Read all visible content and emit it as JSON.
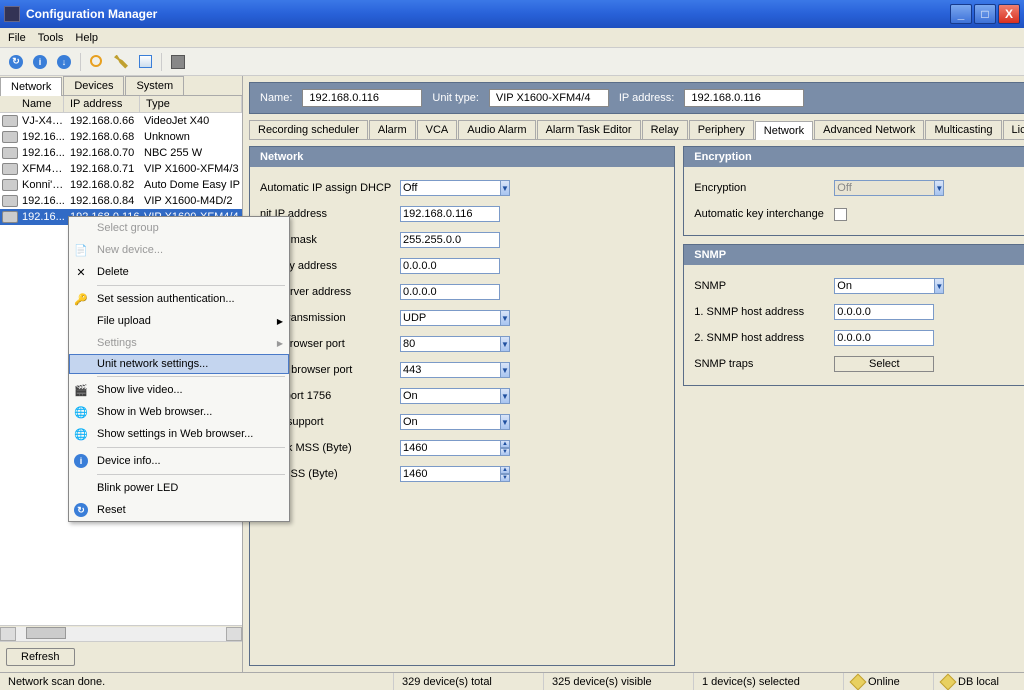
{
  "window": {
    "title": "Configuration Manager"
  },
  "menu": {
    "file": "File",
    "tools": "Tools",
    "help": "Help"
  },
  "left_tabs": {
    "network": "Network",
    "devices": "Devices",
    "system": "System"
  },
  "device_columns": {
    "name": "Name",
    "ip": "IP address",
    "type": "Type"
  },
  "devices": [
    {
      "name": "VJ-X40...",
      "ip": "192.168.0.66",
      "type": "VideoJet X40"
    },
    {
      "name": "192.16...",
      "ip": "192.168.0.68",
      "type": "Unknown"
    },
    {
      "name": "192.16...",
      "ip": "192.168.0.70",
      "type": "NBC 255 W"
    },
    {
      "name": "XFM4A ...",
      "ip": "192.168.0.71",
      "type": "VIP X1600-XFM4/3"
    },
    {
      "name": "Konni's ...",
      "ip": "192.168.0.82",
      "type": "Auto Dome Easy IP"
    },
    {
      "name": "192.16...",
      "ip": "192.168.0.84",
      "type": "VIP X1600-M4D/2"
    },
    {
      "name": "192.16...",
      "ip": "192.168.0.116",
      "type": "VIP X1600-XFM4/4"
    }
  ],
  "context_menu": {
    "select_group": "Select group",
    "new_device": "New device...",
    "delete": "Delete",
    "set_session_auth": "Set session authentication...",
    "file_upload": "File upload",
    "settings": "Settings",
    "unit_network_settings": "Unit network settings...",
    "show_live_video": "Show live video...",
    "show_in_web_browser": "Show in Web browser...",
    "show_settings_web": "Show settings in Web browser...",
    "device_info": "Device info...",
    "blink_power_led": "Blink power LED",
    "reset": "Reset"
  },
  "refresh_btn": "Refresh",
  "info_bar": {
    "name_label": "Name:",
    "name_value": "192.168.0.116",
    "unit_type_label": "Unit type:",
    "unit_type_value": "VIP X1600-XFM4/4",
    "ip_label": "IP address:",
    "ip_value": "192.168.0.116"
  },
  "tabs": {
    "recording": "Recording scheduler",
    "alarm": "Alarm",
    "vca": "VCA",
    "audio_alarm": "Audio Alarm",
    "alarm_task": "Alarm Task Editor",
    "relay": "Relay",
    "periphery": "Periphery",
    "network": "Network",
    "adv_network": "Advanced Network",
    "multicasting": "Multicasting",
    "license": "License"
  },
  "network_panel": {
    "title": "Network",
    "dhcp_label": "Automatic IP assign DHCP",
    "dhcp_value": "Off",
    "unit_ip_label": "nit IP address",
    "unit_ip_value": "192.168.0.116",
    "subnet_label": "ubnet mask",
    "subnet_value": "255.255.0.0",
    "gateway_label": "ateway address",
    "gateway_value": "0.0.0.0",
    "dns_label": "NS server address",
    "dns_value": "0.0.0.0",
    "video_tx_label": "ideo transmission",
    "video_tx_value": "UDP",
    "http_label": "TTP browser port",
    "http_value": "80",
    "https_label": "TTPS browser port",
    "https_value": "443",
    "rcp_label": "CP+ port 1756",
    "rcp_value": "On",
    "telnet_label": "elnet support",
    "telnet_value": "On",
    "mss_label": "etwork MSS (Byte)",
    "mss_value": "1460",
    "iscsi_label": "CSI MSS (Byte)",
    "iscsi_value": "1460"
  },
  "encryption_panel": {
    "title": "Encryption",
    "enc_label": "Encryption",
    "enc_value": "Off",
    "auto_key_label": "Automatic key interchange"
  },
  "snmp_panel": {
    "title": "SNMP",
    "snmp_label": "SNMP",
    "snmp_value": "On",
    "host1_label": "1. SNMP host address",
    "host1_value": "0.0.0.0",
    "host2_label": "2. SNMP host address",
    "host2_value": "0.0.0.0",
    "traps_label": "SNMP traps",
    "traps_btn": "Select"
  },
  "status": {
    "scan": "Network scan done.",
    "total": "329 device(s) total",
    "visible": "325 device(s) visible",
    "selected": "1 device(s) selected",
    "online": "Online",
    "db": "DB local"
  }
}
